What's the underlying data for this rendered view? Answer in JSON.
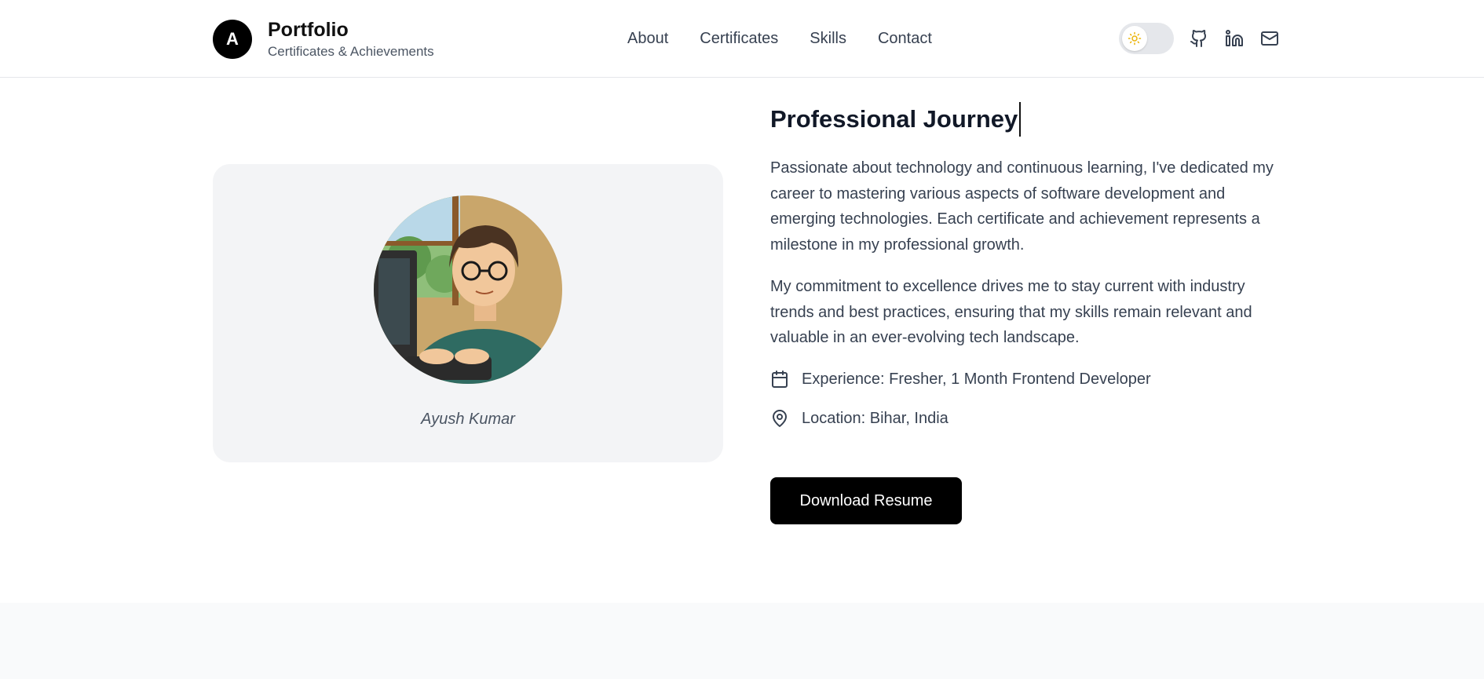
{
  "header": {
    "logo_letter": "A",
    "title": "Portfolio",
    "subtitle": "Certificates & Achievements",
    "nav": [
      "About",
      "Certificates",
      "Skills",
      "Contact"
    ],
    "icons": [
      "sun-icon",
      "github-icon",
      "linkedin-icon",
      "mail-icon"
    ]
  },
  "profile": {
    "name": "Ayush Kumar"
  },
  "about": {
    "title": "Professional Journey",
    "para1": "Passionate about technology and continuous learning, I've dedicated my career to mastering various aspects of software development and emerging technologies. Each certificate and achievement represents a milestone in my professional growth.",
    "para2": "My commitment to excellence drives me to stay current with industry trends and best practices, ensuring that my skills remain relevant and valuable in an ever-evolving tech landscape.",
    "experience": "Experience: Fresher, 1 Month Frontend Developer",
    "location": "Location: Bihar, India",
    "button": "Download Resume"
  },
  "colors": {
    "accent": "#000000",
    "card_bg": "#f3f4f6",
    "sun": "#eab308"
  }
}
